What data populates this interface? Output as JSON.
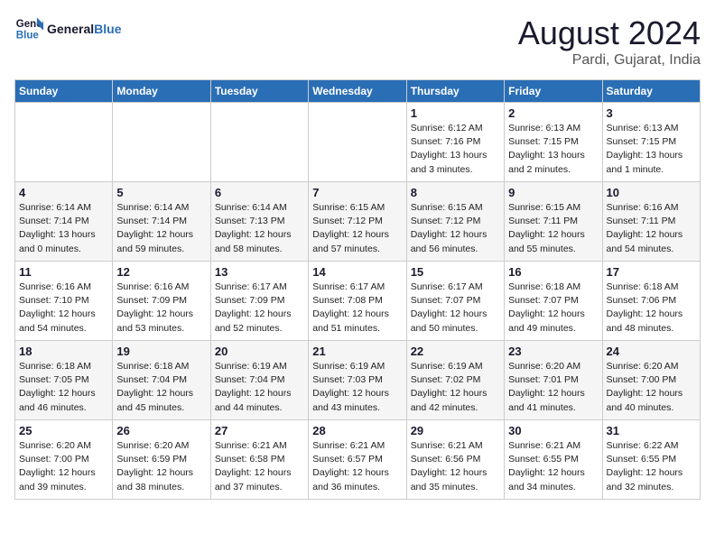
{
  "header": {
    "logo_line1": "General",
    "logo_line2": "Blue",
    "title": "August 2024",
    "subtitle": "Pardi, Gujarat, India"
  },
  "days_of_week": [
    "Sunday",
    "Monday",
    "Tuesday",
    "Wednesday",
    "Thursday",
    "Friday",
    "Saturday"
  ],
  "weeks": [
    [
      {
        "day": "",
        "info": ""
      },
      {
        "day": "",
        "info": ""
      },
      {
        "day": "",
        "info": ""
      },
      {
        "day": "",
        "info": ""
      },
      {
        "day": "1",
        "info": "Sunrise: 6:12 AM\nSunset: 7:16 PM\nDaylight: 13 hours\nand 3 minutes."
      },
      {
        "day": "2",
        "info": "Sunrise: 6:13 AM\nSunset: 7:15 PM\nDaylight: 13 hours\nand 2 minutes."
      },
      {
        "day": "3",
        "info": "Sunrise: 6:13 AM\nSunset: 7:15 PM\nDaylight: 13 hours\nand 1 minute."
      }
    ],
    [
      {
        "day": "4",
        "info": "Sunrise: 6:14 AM\nSunset: 7:14 PM\nDaylight: 13 hours\nand 0 minutes."
      },
      {
        "day": "5",
        "info": "Sunrise: 6:14 AM\nSunset: 7:14 PM\nDaylight: 12 hours\nand 59 minutes."
      },
      {
        "day": "6",
        "info": "Sunrise: 6:14 AM\nSunset: 7:13 PM\nDaylight: 12 hours\nand 58 minutes."
      },
      {
        "day": "7",
        "info": "Sunrise: 6:15 AM\nSunset: 7:12 PM\nDaylight: 12 hours\nand 57 minutes."
      },
      {
        "day": "8",
        "info": "Sunrise: 6:15 AM\nSunset: 7:12 PM\nDaylight: 12 hours\nand 56 minutes."
      },
      {
        "day": "9",
        "info": "Sunrise: 6:15 AM\nSunset: 7:11 PM\nDaylight: 12 hours\nand 55 minutes."
      },
      {
        "day": "10",
        "info": "Sunrise: 6:16 AM\nSunset: 7:11 PM\nDaylight: 12 hours\nand 54 minutes."
      }
    ],
    [
      {
        "day": "11",
        "info": "Sunrise: 6:16 AM\nSunset: 7:10 PM\nDaylight: 12 hours\nand 54 minutes."
      },
      {
        "day": "12",
        "info": "Sunrise: 6:16 AM\nSunset: 7:09 PM\nDaylight: 12 hours\nand 53 minutes."
      },
      {
        "day": "13",
        "info": "Sunrise: 6:17 AM\nSunset: 7:09 PM\nDaylight: 12 hours\nand 52 minutes."
      },
      {
        "day": "14",
        "info": "Sunrise: 6:17 AM\nSunset: 7:08 PM\nDaylight: 12 hours\nand 51 minutes."
      },
      {
        "day": "15",
        "info": "Sunrise: 6:17 AM\nSunset: 7:07 PM\nDaylight: 12 hours\nand 50 minutes."
      },
      {
        "day": "16",
        "info": "Sunrise: 6:18 AM\nSunset: 7:07 PM\nDaylight: 12 hours\nand 49 minutes."
      },
      {
        "day": "17",
        "info": "Sunrise: 6:18 AM\nSunset: 7:06 PM\nDaylight: 12 hours\nand 48 minutes."
      }
    ],
    [
      {
        "day": "18",
        "info": "Sunrise: 6:18 AM\nSunset: 7:05 PM\nDaylight: 12 hours\nand 46 minutes."
      },
      {
        "day": "19",
        "info": "Sunrise: 6:18 AM\nSunset: 7:04 PM\nDaylight: 12 hours\nand 45 minutes."
      },
      {
        "day": "20",
        "info": "Sunrise: 6:19 AM\nSunset: 7:04 PM\nDaylight: 12 hours\nand 44 minutes."
      },
      {
        "day": "21",
        "info": "Sunrise: 6:19 AM\nSunset: 7:03 PM\nDaylight: 12 hours\nand 43 minutes."
      },
      {
        "day": "22",
        "info": "Sunrise: 6:19 AM\nSunset: 7:02 PM\nDaylight: 12 hours\nand 42 minutes."
      },
      {
        "day": "23",
        "info": "Sunrise: 6:20 AM\nSunset: 7:01 PM\nDaylight: 12 hours\nand 41 minutes."
      },
      {
        "day": "24",
        "info": "Sunrise: 6:20 AM\nSunset: 7:00 PM\nDaylight: 12 hours\nand 40 minutes."
      }
    ],
    [
      {
        "day": "25",
        "info": "Sunrise: 6:20 AM\nSunset: 7:00 PM\nDaylight: 12 hours\nand 39 minutes."
      },
      {
        "day": "26",
        "info": "Sunrise: 6:20 AM\nSunset: 6:59 PM\nDaylight: 12 hours\nand 38 minutes."
      },
      {
        "day": "27",
        "info": "Sunrise: 6:21 AM\nSunset: 6:58 PM\nDaylight: 12 hours\nand 37 minutes."
      },
      {
        "day": "28",
        "info": "Sunrise: 6:21 AM\nSunset: 6:57 PM\nDaylight: 12 hours\nand 36 minutes."
      },
      {
        "day": "29",
        "info": "Sunrise: 6:21 AM\nSunset: 6:56 PM\nDaylight: 12 hours\nand 35 minutes."
      },
      {
        "day": "30",
        "info": "Sunrise: 6:21 AM\nSunset: 6:55 PM\nDaylight: 12 hours\nand 34 minutes."
      },
      {
        "day": "31",
        "info": "Sunrise: 6:22 AM\nSunset: 6:55 PM\nDaylight: 12 hours\nand 32 minutes."
      }
    ]
  ]
}
